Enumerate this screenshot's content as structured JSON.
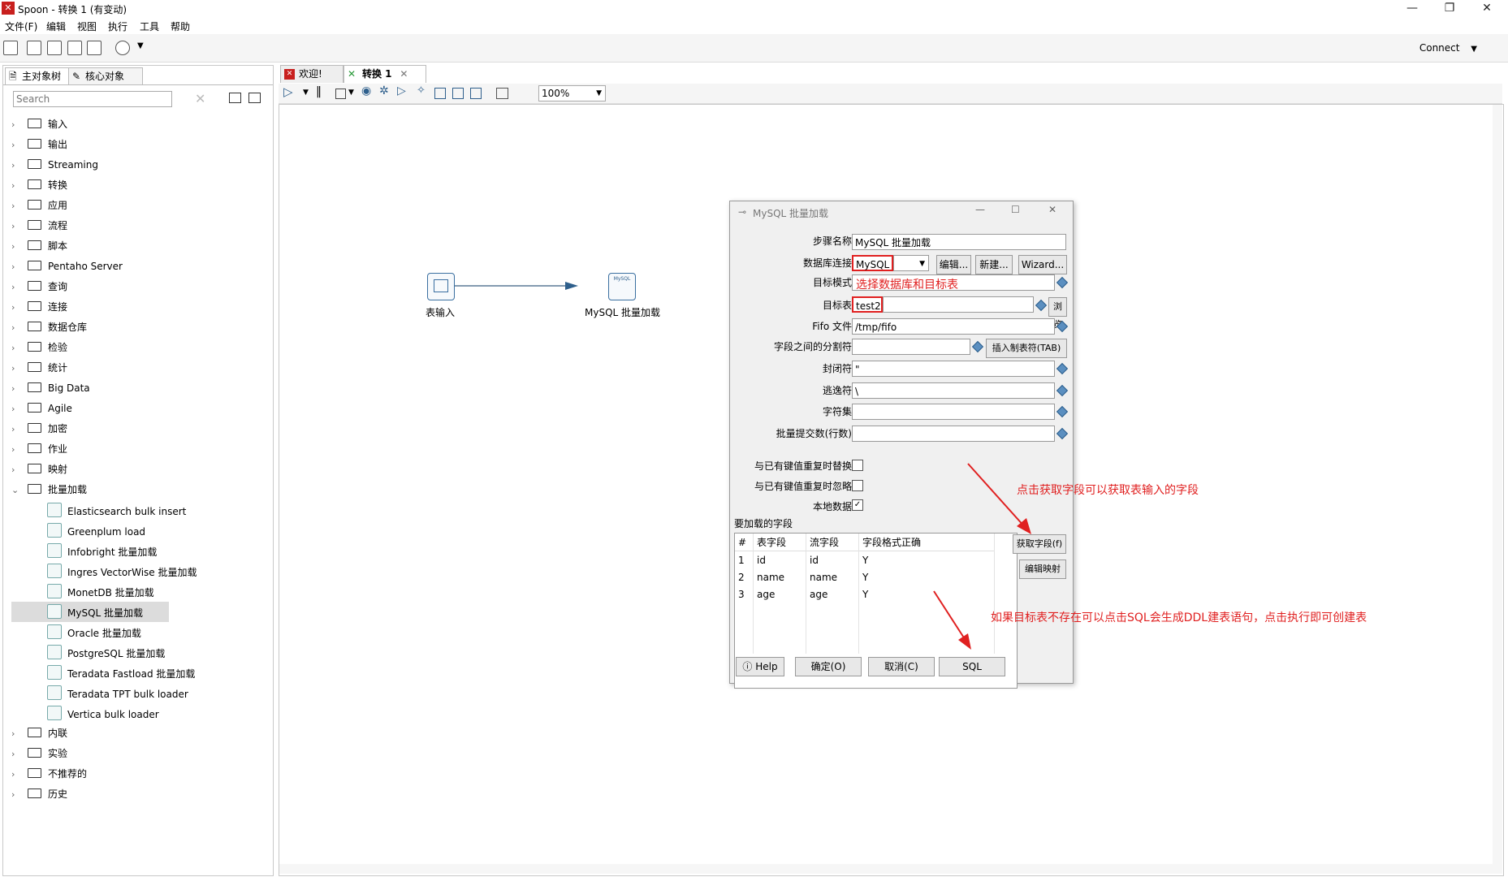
{
  "window": {
    "title": "Spoon - 转换 1 (有变动)",
    "logo_text": "✕",
    "controls": [
      "—",
      "❐",
      "✕"
    ]
  },
  "menu": [
    "文件(F)",
    "编辑",
    "视图",
    "执行",
    "工具",
    "帮助"
  ],
  "toolbar": {
    "connect_label": "Connect"
  },
  "left_panel": {
    "tabs": [
      "主对象树",
      "核心对象"
    ],
    "search_placeholder": "Search",
    "tree": [
      {
        "label": "输入"
      },
      {
        "label": "输出"
      },
      {
        "label": "Streaming"
      },
      {
        "label": "转换"
      },
      {
        "label": "应用"
      },
      {
        "label": "流程"
      },
      {
        "label": "脚本"
      },
      {
        "label": "Pentaho Server"
      },
      {
        "label": "查询"
      },
      {
        "label": "连接"
      },
      {
        "label": "数据仓库"
      },
      {
        "label": "检验"
      },
      {
        "label": "统计"
      },
      {
        "label": "Big Data"
      },
      {
        "label": "Agile"
      },
      {
        "label": "加密"
      },
      {
        "label": "作业"
      },
      {
        "label": "映射"
      },
      {
        "label": "批量加载"
      }
    ],
    "bulk_children": [
      "Elasticsearch bulk insert",
      "Greenplum load",
      "Infobright 批量加载",
      "Ingres VectorWise 批量加载",
      "MonetDB 批量加载",
      "MySQL 批量加载",
      "Oracle 批量加载",
      "PostgreSQL 批量加载",
      "Teradata Fastload 批量加载",
      "Teradata TPT bulk loader",
      "Vertica bulk loader"
    ],
    "tree_after": [
      {
        "label": "内联"
      },
      {
        "label": "实验"
      },
      {
        "label": "不推荐的"
      },
      {
        "label": "历史"
      }
    ]
  },
  "doc_tabs": [
    "欢迎!",
    "转换 1"
  ],
  "zoom": "100%",
  "canvas": {
    "step1_label": "表输入",
    "step2_label": "MySQL 批量加载",
    "step2_icon_text": "MySQL"
  },
  "dialog": {
    "title": "MySQL 批量加载",
    "labels": {
      "step_name": "步骤名称",
      "db_conn": "数据库连接",
      "target_schema": "目标模式",
      "target_table": "目标表",
      "fifo": "Fifo 文件",
      "delimiter": "字段之间的分割符",
      "enclosure": "封闭符",
      "escape": "逃逸符",
      "charset": "字符集",
      "bulk_size": "批量提交数(行数)",
      "replace": "与已有键值重复时替换",
      "ignore": "与已有键值重复时忽略",
      "local": "本地数据",
      "fields": "要加载的字段"
    },
    "values": {
      "step_name": "MySQL 批量加载",
      "db_conn": "MySQL",
      "target_table": "test2",
      "fifo": "/tmp/fifo",
      "enclosure": "\"",
      "escape": "\\"
    },
    "buttons": {
      "edit": "编辑...",
      "new": "新建...",
      "wizard": "Wizard...",
      "browse": "浏览(B)",
      "insert_tab": "插入制表符(TAB)",
      "get_fields": "获取字段(f)",
      "edit_mapping": "编辑映射",
      "help": "Help",
      "ok": "确定(O)",
      "cancel": "取消(C)",
      "sql": "SQL"
    },
    "table": {
      "headers": [
        "#",
        "表字段",
        "流字段",
        "字段格式正确"
      ],
      "rows": [
        [
          "1",
          "id",
          "id",
          "Y"
        ],
        [
          "2",
          "name",
          "name",
          "Y"
        ],
        [
          "3",
          "age",
          "age",
          "Y"
        ]
      ]
    }
  },
  "annotations": {
    "choose": "选择数据库和目标表",
    "get_fields": "点击获取字段可以获取表输入的字段",
    "sql": "如果目标表不存在可以点击SQL会生成DDL建表语句，点击执行即可创建表"
  }
}
